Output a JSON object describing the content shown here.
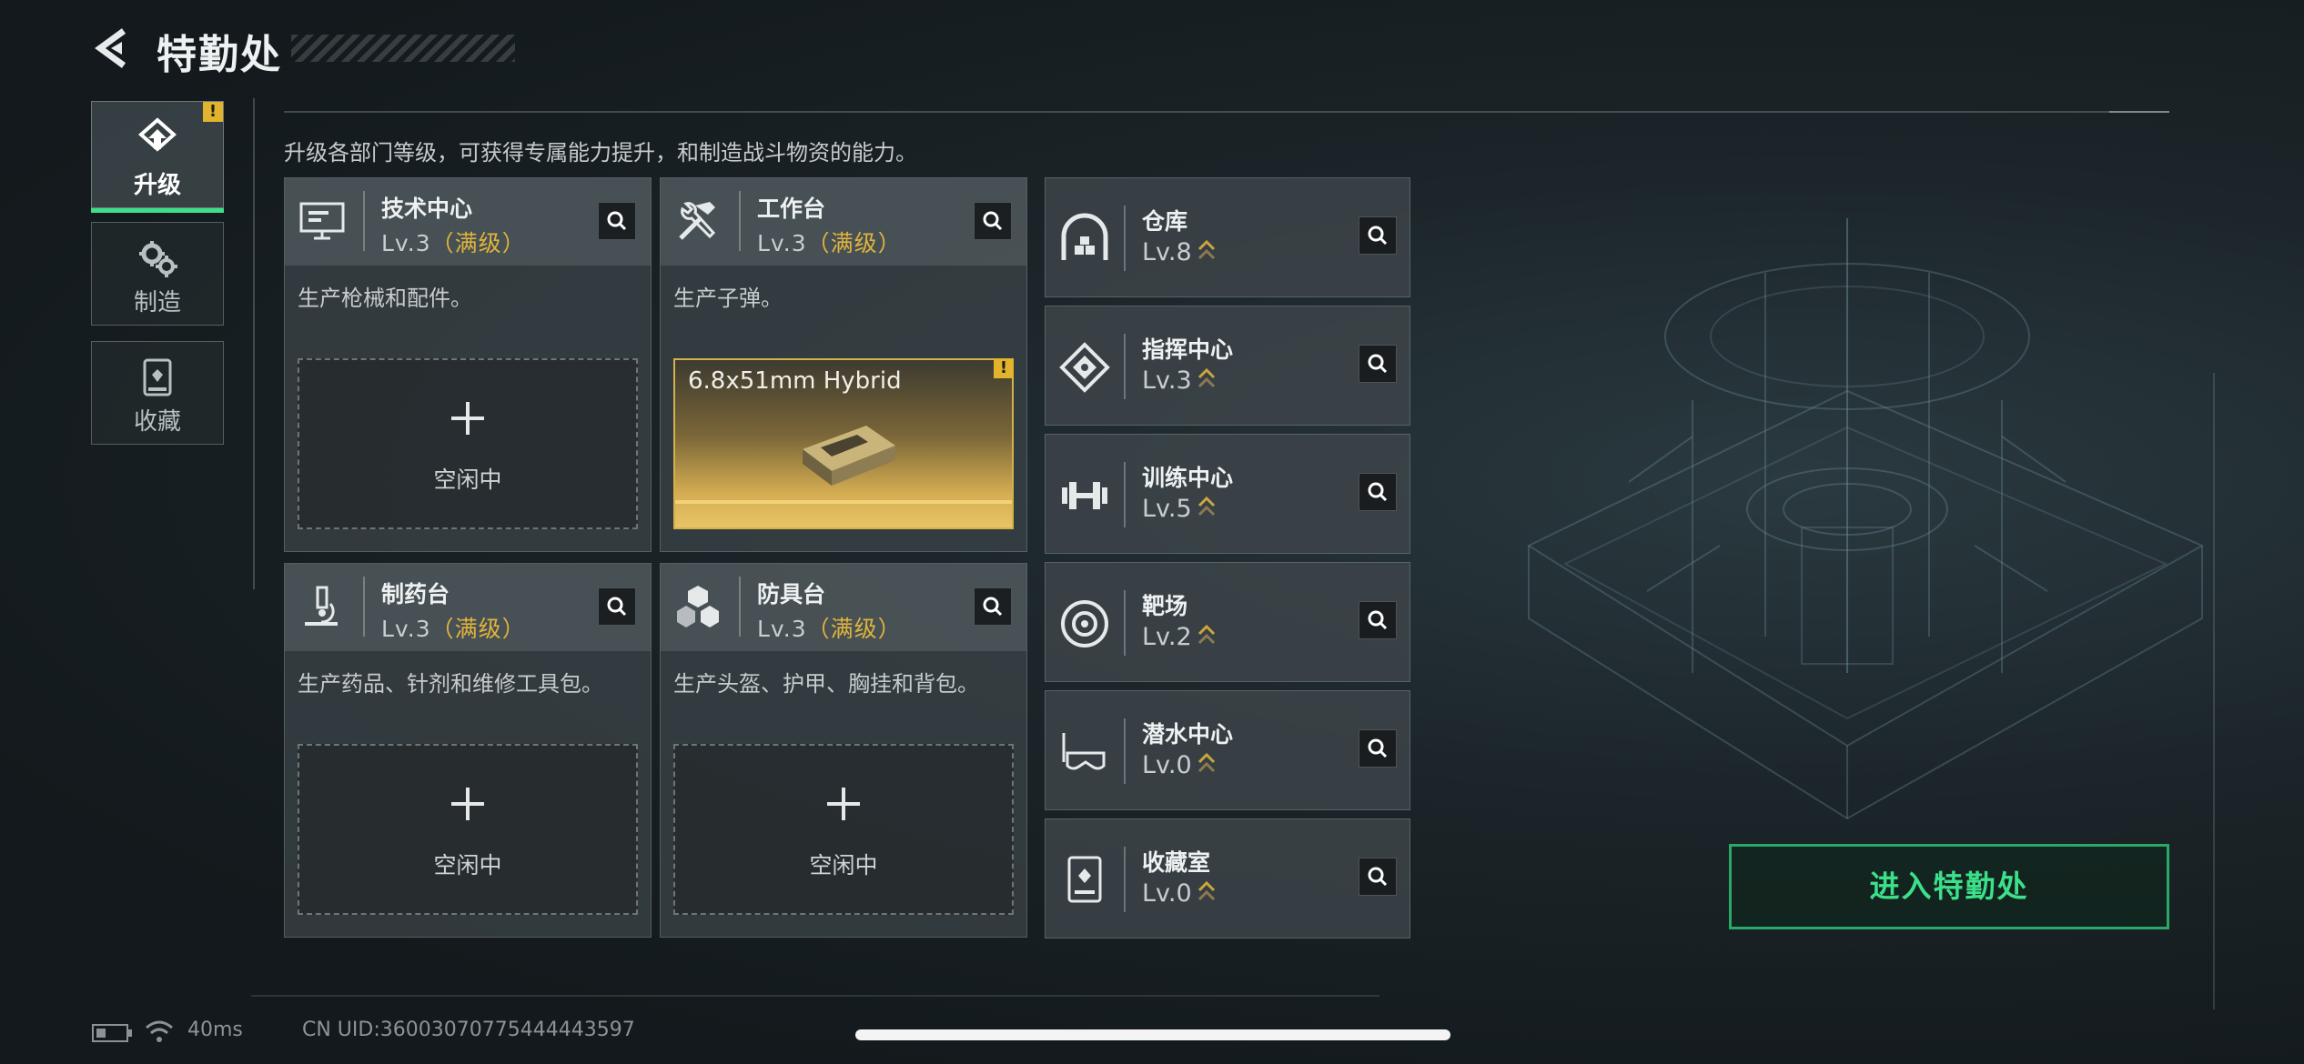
{
  "header": {
    "title": "特勤处"
  },
  "tabs": [
    {
      "label": "升级",
      "active": true,
      "badge": "!"
    },
    {
      "label": "制造",
      "active": false
    },
    {
      "label": "收藏",
      "active": false
    }
  ],
  "intro": "升级各部门等级，可获得专属能力提升，和制造战斗物资的能力。",
  "production_cards": [
    {
      "name": "技术中心",
      "level": "Lv.3",
      "max": "（满级）",
      "desc": "生产枪械和配件。",
      "slot": "空闲中"
    },
    {
      "name": "工作台",
      "level": "Lv.3",
      "max": "（满级）",
      "desc": "生产子弹。",
      "item": "6.8x51mm Hybrid",
      "badge": "!"
    },
    {
      "name": "制药台",
      "level": "Lv.3",
      "max": "（满级）",
      "desc": "生产药品、针剂和维修工具包。",
      "slot": "空闲中"
    },
    {
      "name": "防具台",
      "level": "Lv.3",
      "max": "（满级）",
      "desc": "生产头盔、护甲、胸挂和背包。",
      "slot": "空闲中"
    }
  ],
  "facilities": [
    {
      "name": "仓库",
      "level": "Lv.8",
      "icon": "warehouse-icon"
    },
    {
      "name": "指挥中心",
      "level": "Lv.3",
      "icon": "command-center-icon"
    },
    {
      "name": "训练中心",
      "level": "Lv.5",
      "icon": "dumbbell-icon"
    },
    {
      "name": "靶场",
      "level": "Lv.2",
      "icon": "target-icon"
    },
    {
      "name": "潜水中心",
      "level": "Lv.0",
      "icon": "diving-mask-icon"
    },
    {
      "name": "收藏室",
      "level": "Lv.0",
      "icon": "collection-room-icon"
    }
  ],
  "enter_button": "进入特勤处",
  "status": {
    "ping": "40ms",
    "uid": "CN UID:36003070775444443597"
  },
  "colors": {
    "accent_green": "#3ce08a",
    "max_gold": "#e0b43c",
    "badge_yellow": "#e2b32c"
  }
}
